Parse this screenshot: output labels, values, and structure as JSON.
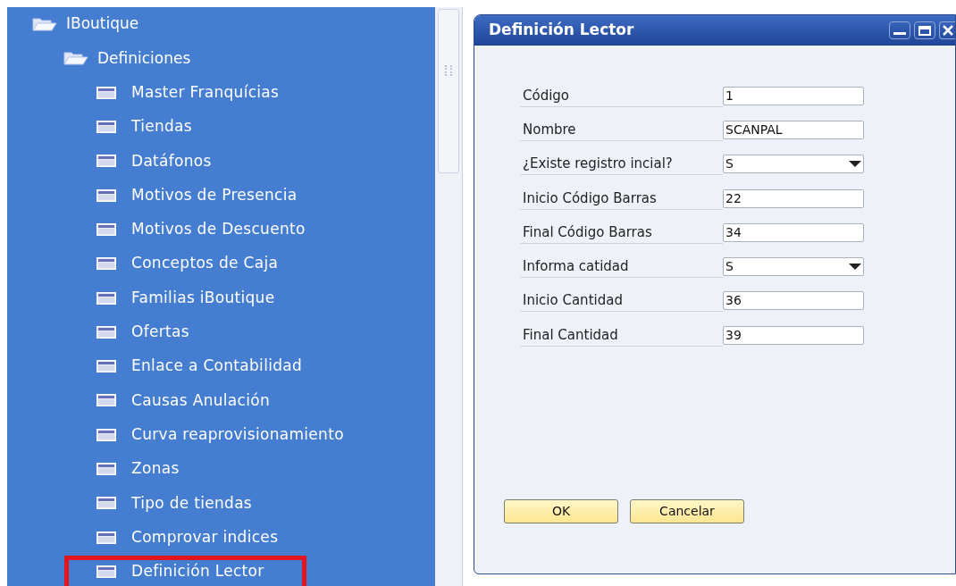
{
  "tree": {
    "label": "IBoutique",
    "expanded": true,
    "children": [
      {
        "label": "Definiciones",
        "expanded": true,
        "children": [
          {
            "label": "Master Franquícias",
            "highlighted": false
          },
          {
            "label": "Tiendas",
            "highlighted": false
          },
          {
            "label": "Datáfonos",
            "highlighted": false
          },
          {
            "label": "Motivos de Presencia",
            "highlighted": false
          },
          {
            "label": "Motivos de Descuento",
            "highlighted": false
          },
          {
            "label": "Conceptos de Caja",
            "highlighted": false
          },
          {
            "label": "Familias iBoutique",
            "highlighted": false
          },
          {
            "label": "Ofertas",
            "highlighted": false
          },
          {
            "label": "Enlace a Contabilidad",
            "highlighted": false
          },
          {
            "label": "Causas Anulación",
            "highlighted": false
          },
          {
            "label": "Curva reaprovisionamiento",
            "highlighted": false
          },
          {
            "label": "Zonas",
            "highlighted": false
          },
          {
            "label": "Tipo de tiendas",
            "highlighted": false
          },
          {
            "label": "Comprovar indices",
            "highlighted": false
          },
          {
            "label": "Definición Lector",
            "highlighted": true
          }
        ]
      }
    ]
  },
  "dialog": {
    "title": "Definición Lector",
    "fields": [
      {
        "label": "Código",
        "kind": "text",
        "value": "1"
      },
      {
        "label": "Nombre",
        "kind": "text",
        "value": "SCANPAL"
      },
      {
        "label": "¿Existe registro incial?",
        "kind": "dropdown",
        "value": "S"
      },
      {
        "label": "Inicio Código Barras",
        "kind": "text",
        "value": "22"
      },
      {
        "label": "Final Código Barras",
        "kind": "text",
        "value": "34"
      },
      {
        "label": "Informa catidad",
        "kind": "dropdown",
        "value": "S"
      },
      {
        "label": "Inicio Cantidad",
        "kind": "text",
        "value": "36"
      },
      {
        "label": "Final Cantidad",
        "kind": "text",
        "value": "39"
      }
    ],
    "buttons": [
      "OK",
      "Cancelar"
    ]
  }
}
